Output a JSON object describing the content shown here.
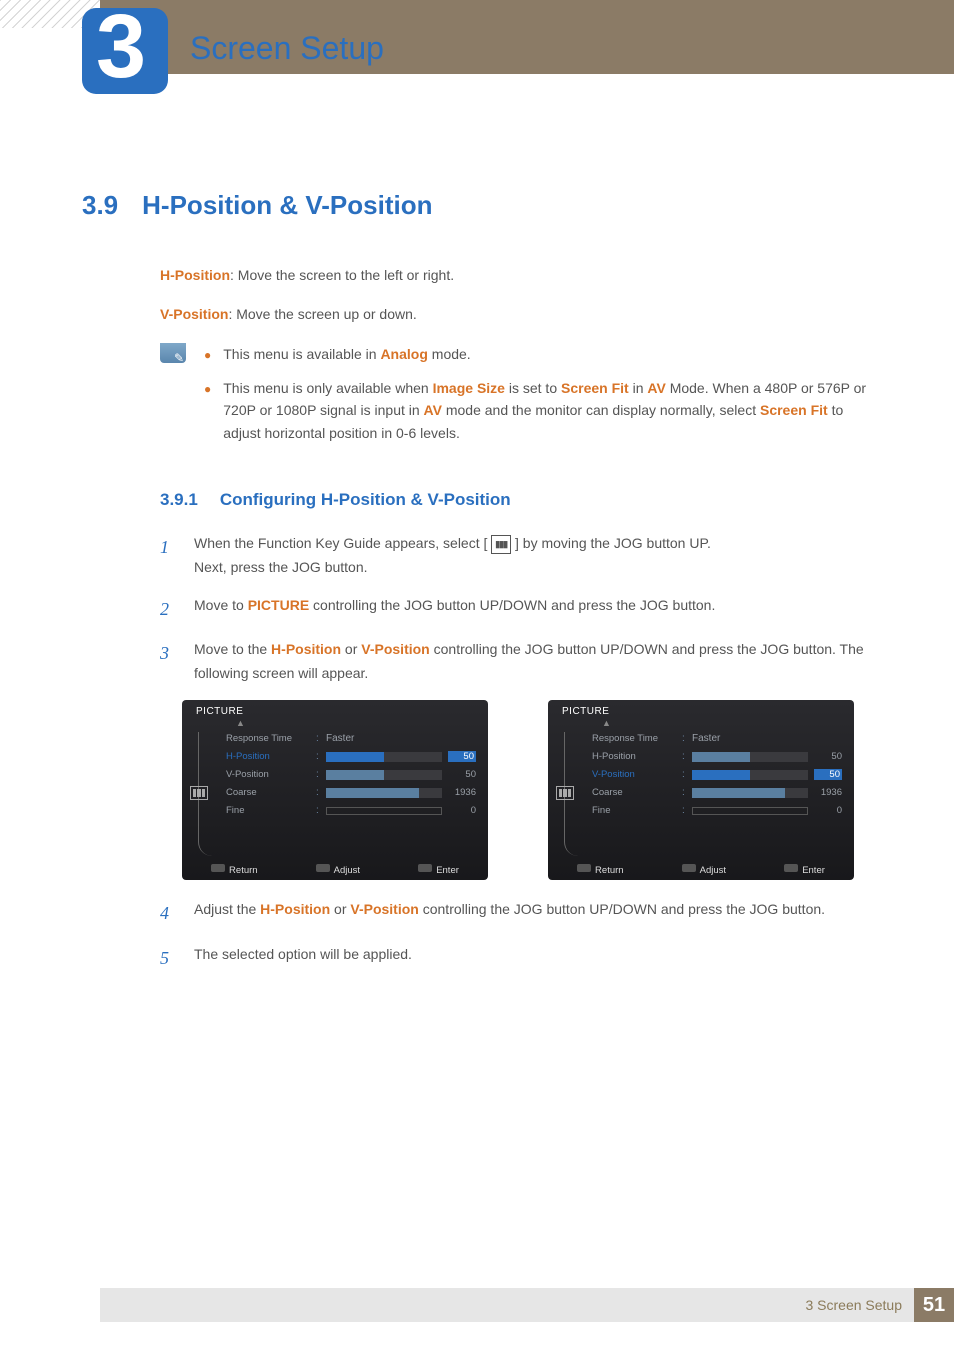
{
  "chapter": {
    "number": "3",
    "title": "Screen Setup"
  },
  "section": {
    "number": "3.9",
    "title": "H-Position & V-Position"
  },
  "intro": {
    "hpos_label": "H-Position",
    "hpos_text": ": Move the screen to the left or right.",
    "vpos_label": "V-Position",
    "vpos_text": ": Move the screen up or down."
  },
  "notes": {
    "n1_pre": "This menu is available in ",
    "n1_hl": "Analog",
    "n1_post": " mode.",
    "n2_pre": "This menu is only available when ",
    "n2_hl1": "Image Size",
    "n2_mid1": " is set to ",
    "n2_hl2": "Screen Fit",
    "n2_mid2": " in ",
    "n2_hl3": "AV",
    "n2_mid3": " Mode. When a 480P or 576P or 720P or 1080P signal is input in ",
    "n2_hl4": "AV",
    "n2_mid4": " mode and the monitor can display normally, select ",
    "n2_hl5": "Screen Fit",
    "n2_post": " to adjust horizontal position in 0-6 levels."
  },
  "subsection": {
    "number": "3.9.1",
    "title": "Configuring H-Position & V-Position"
  },
  "steps": {
    "s1a": "When the Function Key Guide appears, select ",
    "s1b": " by moving the JOG button UP.",
    "s1c": "Next, press the JOG button.",
    "s2a": "Move to ",
    "s2hl": "PICTURE",
    "s2b": " controlling the JOG button UP/DOWN and press the JOG button.",
    "s3a": "Move to the ",
    "s3hl1": "H-Position",
    "s3b": " or  ",
    "s3hl2": "V-Position",
    "s3c": " controlling the JOG button UP/DOWN and press the JOG button. The following screen will appear.",
    "s4a": "Adjust the ",
    "s4hl1": "H-Position",
    "s4b": " or ",
    "s4hl2": "V-Position",
    "s4c": " controlling the JOG button UP/DOWN and press the JOG button.",
    "s5": "The selected option will be applied."
  },
  "osd": {
    "title": "PICTURE",
    "items": {
      "rt_label": "Response Time",
      "rt_value": "Faster",
      "hp_label": "H-Position",
      "hp_value": "50",
      "vp_label": "V-Position",
      "vp_value": "50",
      "co_label": "Coarse",
      "co_value": "1936",
      "fi_label": "Fine",
      "fi_value": "0"
    },
    "footer": {
      "return": "Return",
      "adjust": "Adjust",
      "enter": "Enter"
    }
  },
  "footer": {
    "text": "3 Screen Setup",
    "page": "51"
  }
}
